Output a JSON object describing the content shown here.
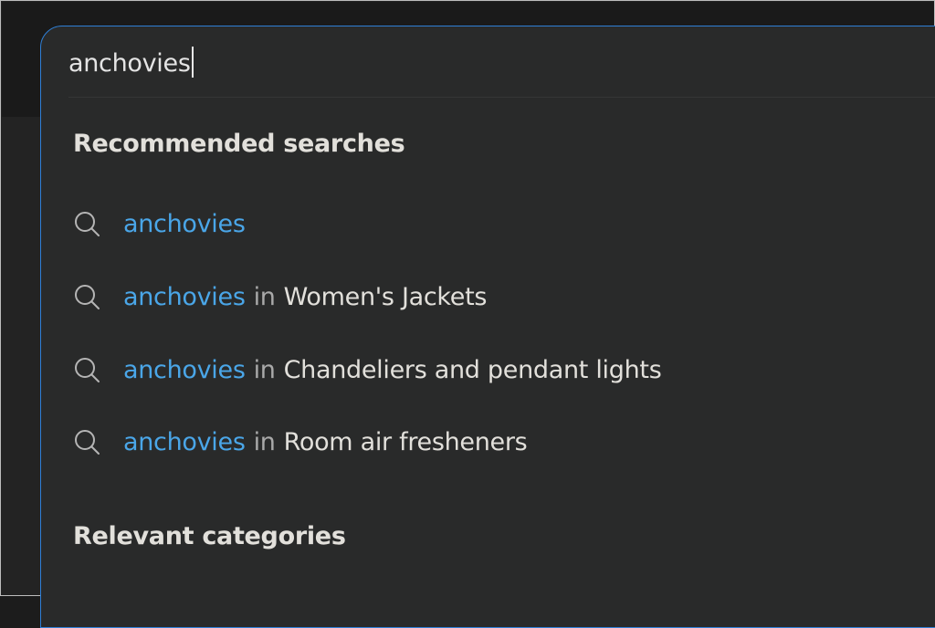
{
  "search": {
    "value": "anchovies"
  },
  "sections": {
    "recommended_title": "Recommended searches",
    "relevant_title": "Relevant categories"
  },
  "suggestions": [
    {
      "query": "anchovies",
      "connector": "",
      "category": ""
    },
    {
      "query": "anchovies",
      "connector": "in",
      "category": "Women's Jackets"
    },
    {
      "query": "anchovies",
      "connector": "in",
      "category": "Chandeliers and pendant lights"
    },
    {
      "query": "anchovies",
      "connector": "in",
      "category": "Room air fresheners"
    }
  ],
  "colors": {
    "accent": "#4aa6e8",
    "panel_background": "#292a2a",
    "border_focus": "#2f7fd6"
  },
  "icons": {
    "suggestion_icon": "search-icon"
  }
}
